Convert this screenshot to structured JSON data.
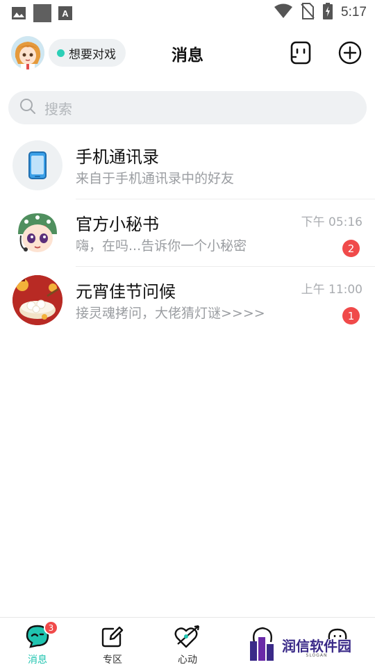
{
  "status_bar": {
    "time": "5:17",
    "left_icons": [
      "image-icon",
      "square-icon",
      "font-icon"
    ],
    "right_icons": [
      "wifi-icon",
      "no-sim-icon",
      "battery-charging-icon"
    ]
  },
  "header": {
    "title": "消息",
    "status_label": "想要对戏",
    "status_color": "#2ccfb7",
    "buttons": [
      "robot-face-icon",
      "add-circle-icon"
    ]
  },
  "search": {
    "placeholder": "搜索"
  },
  "conversations": [
    {
      "name": "手机通讯录",
      "preview": "来自于手机通讯录中的好友",
      "time": "",
      "unread": "",
      "icon": "phone-icon"
    },
    {
      "name": "官方小秘书",
      "preview": "嗨，在吗...告诉你一个小秘密",
      "time": "下午 05:16",
      "unread": "2",
      "icon": "secretary-avatar"
    },
    {
      "name": "元宵佳节问候",
      "preview": "接灵魂拷问，大佬猜灯谜>>>>",
      "time": "上午 11:00",
      "unread": "1",
      "icon": "lantern-festival-avatar"
    }
  ],
  "bottom_nav": {
    "active_color": "#20c4b0",
    "badge_color": "#f04a4a",
    "tabs": [
      {
        "label": "消息",
        "icon": "message-icon",
        "badge": "3"
      },
      {
        "label": "专区",
        "icon": "edit-icon",
        "badge": ""
      },
      {
        "label": "心动",
        "icon": "heart-arrow-icon",
        "badge": ""
      }
    ]
  },
  "watermark": {
    "text": "润信软件园",
    "sub": "SLOGAN"
  }
}
